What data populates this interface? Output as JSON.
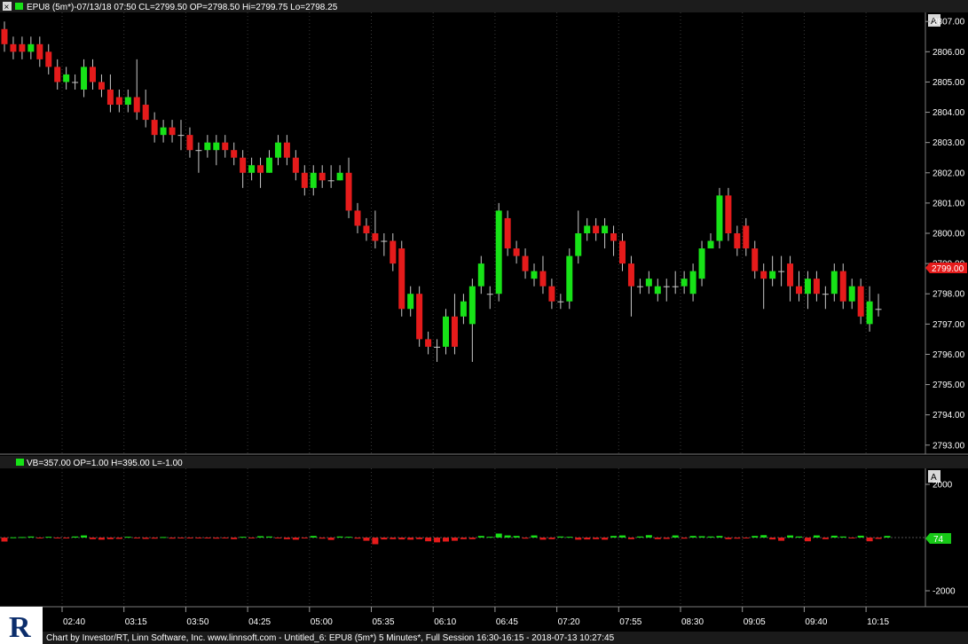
{
  "price_panel": {
    "header": "EPU8 (5m*)-07/13/18 07:50 CL=2799.50 OP=2798.50 Hi=2799.75 Lo=2798.25",
    "close_icon": "close-icon",
    "scale_button": "A",
    "last_price_label": "2799.00"
  },
  "volume_panel": {
    "header": "VB=357.00 OP=1.00 H=395.00 L=-1.00",
    "scale_button": "A",
    "last_value_label": "74"
  },
  "footer": {
    "text": "Chart by Investor/RT, Linn Software, Inc. www.linnsoft.com - Untitled_6: EPU8 (5m*) 5 Minutes*, Full Session 16:30-16:15 - 2018-07-13 10:27:45",
    "logo_letter": "R"
  },
  "colors": {
    "up": "#17e217",
    "down": "#e51b1b",
    "grid": "#3a3a3a",
    "background": "#000000"
  },
  "chart_data": [
    {
      "type": "candlestick",
      "yticks": [
        "2807.00",
        "2806.00",
        "2805.00",
        "2804.00",
        "2803.00",
        "2802.00",
        "2801.00",
        "2800.00",
        "2799.00",
        "2798.00",
        "2797.00",
        "2796.00",
        "2795.00",
        "2794.00",
        "2793.00"
      ],
      "ylim": [
        2792.7,
        2807.3
      ],
      "xticks": [
        "02:40",
        "03:15",
        "03:50",
        "04:25",
        "05:00",
        "05:35",
        "06:10",
        "06:45",
        "07:20",
        "07:55",
        "08:30",
        "09:05",
        "09:40",
        "10:15"
      ],
      "bar_count": 101,
      "candles": [
        [
          2806.75,
          2806.25,
          2807.0,
          2806.0
        ],
        [
          2806.25,
          2806.0,
          2806.5,
          2805.75
        ],
        [
          2806.25,
          2806.0,
          2806.5,
          2805.75
        ],
        [
          2806.0,
          2806.25,
          2806.5,
          2805.75
        ],
        [
          2806.25,
          2805.75,
          2806.5,
          2805.5
        ],
        [
          2806.0,
          2805.5,
          2806.25,
          2805.25
        ],
        [
          2805.5,
          2805.0,
          2805.75,
          2804.75
        ],
        [
          2805.0,
          2805.25,
          2805.5,
          2804.75
        ],
        [
          2805.0,
          2805.0,
          2805.25,
          2804.75
        ],
        [
          2804.75,
          2805.5,
          2805.75,
          2804.5
        ],
        [
          2805.5,
          2805.0,
          2805.75,
          2804.75
        ],
        [
          2805.0,
          2804.75,
          2805.25,
          2804.5
        ],
        [
          2804.75,
          2804.25,
          2805.25,
          2804.0
        ],
        [
          2804.5,
          2804.25,
          2804.75,
          2804.0
        ],
        [
          2804.25,
          2804.5,
          2804.75,
          2804.0
        ],
        [
          2804.5,
          2804.0,
          2805.75,
          2803.75
        ],
        [
          2804.25,
          2803.75,
          2804.75,
          2803.5
        ],
        [
          2803.75,
          2803.25,
          2804.0,
          2803.0
        ],
        [
          2803.25,
          2803.5,
          2803.75,
          2803.0
        ],
        [
          2803.5,
          2803.25,
          2803.75,
          2803.0
        ],
        [
          2803.25,
          2803.25,
          2803.75,
          2802.75
        ],
        [
          2803.25,
          2802.75,
          2803.5,
          2802.5
        ],
        [
          2802.75,
          2802.75,
          2803.0,
          2802.0
        ],
        [
          2802.75,
          2803.0,
          2803.25,
          2802.5
        ],
        [
          2802.75,
          2803.0,
          2803.25,
          2802.25
        ],
        [
          2803.0,
          2802.75,
          2803.25,
          2802.5
        ],
        [
          2802.75,
          2802.5,
          2803.0,
          2802.25
        ],
        [
          2802.5,
          2802.0,
          2802.75,
          2801.5
        ],
        [
          2802.0,
          2802.25,
          2802.5,
          2801.75
        ],
        [
          2802.25,
          2802.0,
          2802.5,
          2801.5
        ],
        [
          2802.0,
          2802.5,
          2802.75,
          2802.0
        ],
        [
          2802.5,
          2803.0,
          2803.25,
          2802.25
        ],
        [
          2803.0,
          2802.5,
          2803.25,
          2802.25
        ],
        [
          2802.5,
          2802.0,
          2802.75,
          2801.75
        ],
        [
          2802.0,
          2801.5,
          2802.25,
          2801.25
        ],
        [
          2801.5,
          2802.0,
          2802.25,
          2801.25
        ],
        [
          2802.0,
          2801.75,
          2802.25,
          2801.5
        ],
        [
          2801.75,
          2801.75,
          2802.25,
          2801.5
        ],
        [
          2801.75,
          2802.0,
          2802.25,
          2801.75
        ],
        [
          2802.0,
          2800.75,
          2802.5,
          2800.5
        ],
        [
          2800.75,
          2800.25,
          2801.0,
          2800.0
        ],
        [
          2800.25,
          2800.0,
          2800.5,
          2799.75
        ],
        [
          2800.0,
          2799.75,
          2800.75,
          2799.5
        ],
        [
          2799.75,
          2799.75,
          2800.0,
          2799.25
        ],
        [
          2799.75,
          2799.0,
          2800.0,
          2798.75
        ],
        [
          2799.5,
          2797.5,
          2799.75,
          2797.25
        ],
        [
          2797.5,
          2798.0,
          2798.25,
          2797.25
        ],
        [
          2798.0,
          2796.5,
          2798.25,
          2796.25
        ],
        [
          2796.5,
          2796.25,
          2796.75,
          2796.0
        ],
        [
          2796.25,
          2796.25,
          2796.5,
          2795.75
        ],
        [
          2796.25,
          2797.25,
          2797.5,
          2796.0
        ],
        [
          2797.25,
          2796.25,
          2798.0,
          2796.0
        ],
        [
          2797.25,
          2797.75,
          2798.0,
          2797.0
        ],
        [
          2797.0,
          2798.25,
          2798.5,
          2795.75
        ],
        [
          2798.25,
          2799.0,
          2799.25,
          2798.0
        ],
        [
          2798.0,
          2798.0,
          2798.25,
          2797.5
        ],
        [
          2798.0,
          2800.75,
          2801.0,
          2797.75
        ],
        [
          2800.5,
          2799.5,
          2800.75,
          2799.25
        ],
        [
          2799.5,
          2799.25,
          2799.75,
          2799.0
        ],
        [
          2799.25,
          2798.75,
          2799.5,
          2798.5
        ],
        [
          2798.5,
          2798.75,
          2799.0,
          2798.25
        ],
        [
          2798.75,
          2798.25,
          2799.25,
          2798.0
        ],
        [
          2798.25,
          2797.75,
          2798.5,
          2797.5
        ],
        [
          2797.75,
          2797.75,
          2798.0,
          2797.5
        ],
        [
          2797.75,
          2799.25,
          2799.5,
          2797.5
        ],
        [
          2799.25,
          2800.0,
          2800.75,
          2799.0
        ],
        [
          2800.0,
          2800.25,
          2800.5,
          2799.75
        ],
        [
          2800.25,
          2800.0,
          2800.5,
          2799.75
        ],
        [
          2800.0,
          2800.25,
          2800.5,
          2799.5
        ],
        [
          2800.0,
          2799.75,
          2800.25,
          2799.25
        ],
        [
          2799.75,
          2799.0,
          2800.0,
          2798.75
        ],
        [
          2799.0,
          2798.25,
          2799.25,
          2797.25
        ],
        [
          2798.25,
          2798.25,
          2798.5,
          2798.0
        ],
        [
          2798.25,
          2798.5,
          2798.75,
          2798.0
        ],
        [
          2798.0,
          2798.25,
          2798.5,
          2797.75
        ],
        [
          2798.25,
          2798.25,
          2798.5,
          2797.75
        ],
        [
          2798.25,
          2798.25,
          2798.75,
          2798.0
        ],
        [
          2798.25,
          2798.5,
          2798.75,
          2798.0
        ],
        [
          2798.0,
          2798.75,
          2799.0,
          2797.75
        ],
        [
          2798.5,
          2799.5,
          2799.75,
          2798.25
        ],
        [
          2799.5,
          2799.75,
          2800.0,
          2799.5
        ],
        [
          2799.75,
          2801.25,
          2801.5,
          2799.5
        ],
        [
          2801.25,
          2800.0,
          2801.5,
          2799.75
        ],
        [
          2800.0,
          2799.5,
          2800.25,
          2799.25
        ],
        [
          2800.25,
          2799.5,
          2800.5,
          2799.25
        ],
        [
          2799.5,
          2798.75,
          2799.75,
          2798.5
        ],
        [
          2798.75,
          2798.5,
          2799.0,
          2797.5
        ],
        [
          2798.5,
          2798.75,
          2799.25,
          2798.25
        ],
        [
          2798.75,
          2798.75,
          2799.25,
          2798.25
        ],
        [
          2799.0,
          2798.25,
          2799.25,
          2797.75
        ],
        [
          2798.25,
          2798.0,
          2798.75,
          2797.75
        ],
        [
          2798.0,
          2798.5,
          2798.75,
          2797.5
        ],
        [
          2798.5,
          2798.0,
          2798.75,
          2797.75
        ],
        [
          2798.0,
          2798.0,
          2798.25,
          2797.5
        ],
        [
          2798.0,
          2798.75,
          2799.0,
          2797.75
        ],
        [
          2798.75,
          2797.75,
          2799.0,
          2797.5
        ],
        [
          2797.75,
          2798.25,
          2798.5,
          2797.5
        ],
        [
          2798.25,
          2797.25,
          2798.5,
          2797.0
        ],
        [
          2797.0,
          2797.75,
          2798.25,
          2796.75
        ],
        [
          2797.5,
          2797.5,
          2798.0,
          2797.25
        ]
      ]
    },
    {
      "type": "bar",
      "yticks": [
        "2000",
        "-2000"
      ],
      "ylim": [
        -2600,
        2600
      ],
      "values": [
        -150,
        10,
        20,
        40,
        -10,
        30,
        -20,
        -10,
        40,
        80,
        -60,
        -80,
        -60,
        -50,
        30,
        -30,
        -50,
        -40,
        20,
        -40,
        -30,
        -20,
        -30,
        -20,
        -40,
        -30,
        -60,
        30,
        -20,
        50,
        40,
        -30,
        -60,
        -80,
        -20,
        60,
        -40,
        -90,
        40,
        30,
        -40,
        -120,
        -250,
        -70,
        -60,
        -70,
        -80,
        -60,
        -140,
        -180,
        -150,
        -120,
        -60,
        -60,
        60,
        30,
        150,
        80,
        60,
        -40,
        80,
        -80,
        -60,
        40,
        30,
        -80,
        -70,
        -60,
        -80,
        60,
        80,
        -60,
        40,
        90,
        -60,
        -50,
        80,
        -40,
        60,
        50,
        40,
        60,
        -60,
        -40,
        -30,
        60,
        90,
        -70,
        -120,
        80,
        40,
        -140,
        80,
        -60,
        70,
        40,
        -30,
        70,
        -140,
        -50,
        60
      ]
    }
  ]
}
